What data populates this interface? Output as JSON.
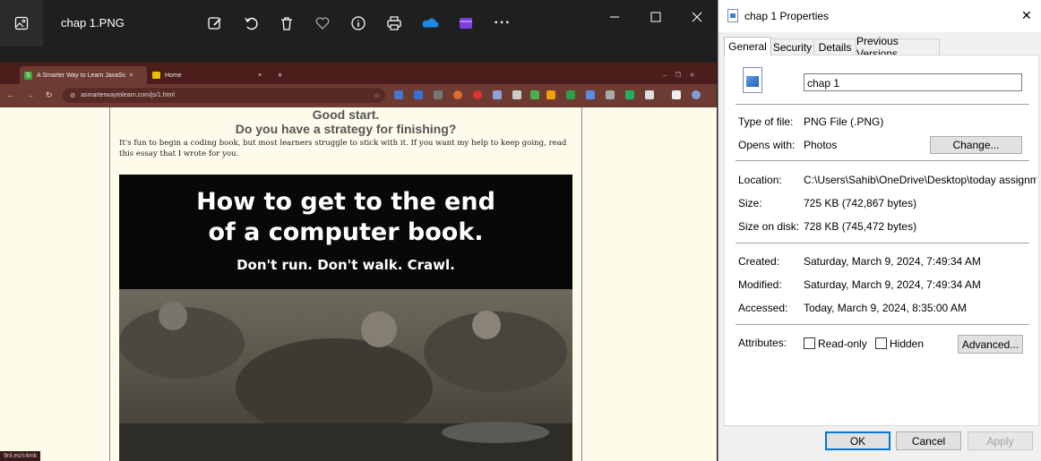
{
  "viewer": {
    "title": "chap 1.PNG",
    "toolbar": [
      "edit-image-icon",
      "rotate-icon",
      "delete-icon",
      "favorite-icon",
      "info-icon",
      "print-icon",
      "onedrive-icon",
      "clipchamp-icon",
      "more-icon"
    ],
    "more_label": "···"
  },
  "browser": {
    "tabs": [
      {
        "label": "A Smarter Way to Learn JavaSc",
        "close": "×"
      },
      {
        "label": "Home",
        "close": "×"
      }
    ],
    "new_tab": "+",
    "url": "asmarterwaytolearn.com/js/1.html",
    "status_url": "9nl.es/c4mk",
    "page": {
      "heading1": "Good start.",
      "heading2": "Do you have a strategy for finishing?",
      "paragraph": "It's fun to begin a coding book, but most learners struggle to stick with it. If you want my help to keep going, read this essay that I wrote for you.",
      "banner_line1": "How to get to the end",
      "banner_line2": "of a computer book.",
      "banner_line3": "Don't run. Don't walk. Crawl."
    }
  },
  "dialog": {
    "title": "chap 1 Properties",
    "close": "✕",
    "tabs": [
      "General",
      "Security",
      "Details",
      "Previous Versions"
    ],
    "filename": "chap 1",
    "type_label": "Type of file:",
    "type_value": "PNG File (.PNG)",
    "opens_label": "Opens with:",
    "opens_value": "Photos",
    "change_button": "Change...",
    "location_label": "Location:",
    "location_value": "C:\\Users\\Sahib\\OneDrive\\Desktop\\today assignme",
    "size_label": "Size:",
    "size_value": "725 KB (742,867 bytes)",
    "size_disk_label": "Size on disk:",
    "size_disk_value": "728 KB (745,472 bytes)",
    "created_label": "Created:",
    "created_value": "Saturday, March 9, 2024, 7:49:34 AM",
    "modified_label": "Modified:",
    "modified_value": "Saturday, March 9, 2024, 7:49:34 AM",
    "accessed_label": "Accessed:",
    "accessed_value": "Today, March 9, 2024, 8:35:00 AM",
    "attributes_label": "Attributes:",
    "readonly_label": "Read-only",
    "hidden_label": "Hidden",
    "advanced_button": "Advanced...",
    "ok_button": "OK",
    "cancel_button": "Cancel",
    "apply_button": "Apply"
  }
}
